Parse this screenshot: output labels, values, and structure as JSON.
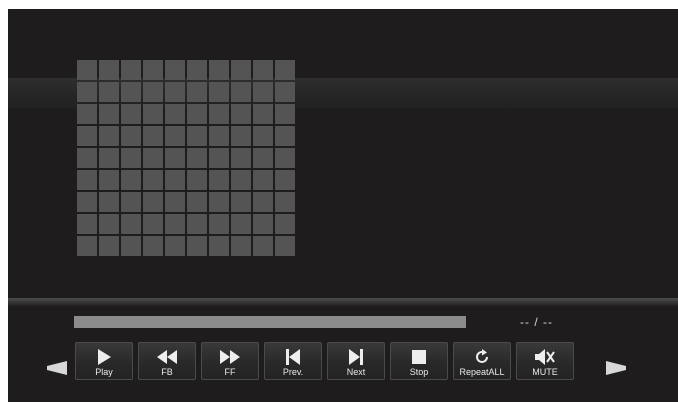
{
  "player": {
    "time_display": "-- / --",
    "progress": 0,
    "accent": "#bdbcbc",
    "album_art": {
      "icon": "placeholder-grid-icon",
      "rows": 9,
      "cols": 10
    }
  },
  "controls": [
    {
      "key": "play",
      "label": "Play",
      "icon": "play-icon"
    },
    {
      "key": "fb",
      "label": "FB",
      "icon": "fast-backward-icon"
    },
    {
      "key": "ff",
      "label": "FF",
      "icon": "fast-forward-icon"
    },
    {
      "key": "prev",
      "label": "Prev.",
      "icon": "skip-previous-icon"
    },
    {
      "key": "next",
      "label": "Next",
      "icon": "skip-next-icon"
    },
    {
      "key": "stop",
      "label": "Stop",
      "icon": "stop-icon"
    },
    {
      "key": "repeat",
      "label": "RepeatALL",
      "icon": "repeat-icon"
    },
    {
      "key": "mute",
      "label": "MUTE",
      "icon": "mute-icon"
    }
  ],
  "navigation": {
    "left_icon": "arrow-left-icon",
    "right_icon": "arrow-right-icon"
  }
}
